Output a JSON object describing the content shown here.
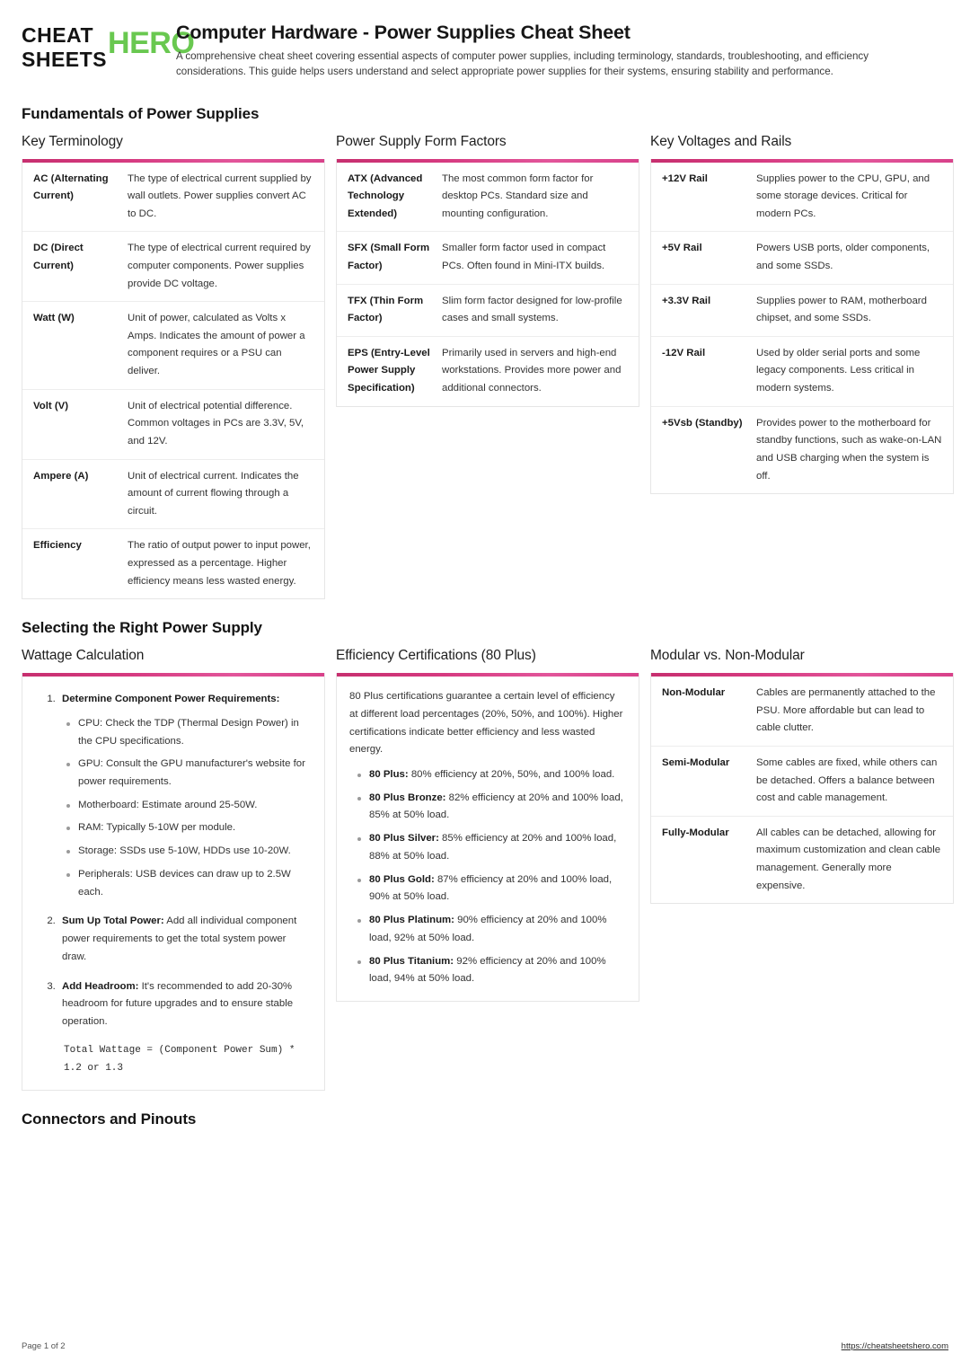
{
  "brand": {
    "logo_line1": "CHEAT",
    "logo_line2": "SHEETS",
    "logo_accent": "HERO",
    "accent_green": "#69c850",
    "accent_pink": "#d6367a"
  },
  "header": {
    "title": "Computer Hardware - Power Supplies Cheat Sheet",
    "subtitle": "A comprehensive cheat sheet covering essential aspects of computer power supplies, including terminology, standards, troubleshooting, and efficiency considerations. This guide helps users understand and select appropriate power supplies for their systems, ensuring stability and performance."
  },
  "sections": [
    {
      "heading": "Fundamentals of Power Supplies"
    },
    {
      "heading": "Selecting the Right Power Supply"
    },
    {
      "heading": "Connectors and Pinouts"
    }
  ],
  "cards": {
    "key_terminology": {
      "title": "Key Terminology",
      "rows": [
        {
          "term": "AC (Alternating Current)",
          "desc": "The type of electrical current supplied by wall outlets. Power supplies convert AC to DC."
        },
        {
          "term": "DC (Direct Current)",
          "desc": "The type of electrical current required by computer components. Power supplies provide DC voltage."
        },
        {
          "term": "Watt (W)",
          "desc": "Unit of power, calculated as Volts x Amps. Indicates the amount of power a component requires or a PSU can deliver."
        },
        {
          "term": "Volt (V)",
          "desc": "Unit of electrical potential difference. Common voltages in PCs are 3.3V, 5V, and 12V."
        },
        {
          "term": "Ampere (A)",
          "desc": "Unit of electrical current. Indicates the amount of current flowing through a circuit."
        },
        {
          "term": "Efficiency",
          "desc": "The ratio of output power to input power, expressed as a percentage. Higher efficiency means less wasted energy."
        }
      ]
    },
    "form_factors": {
      "title": "Power Supply Form Factors",
      "rows": [
        {
          "term": "ATX (Advanced Technology Extended)",
          "desc": "The most common form factor for desktop PCs. Standard size and mounting configuration."
        },
        {
          "term": "SFX (Small Form Factor)",
          "desc": "Smaller form factor used in compact PCs. Often found in Mini-ITX builds."
        },
        {
          "term": "TFX (Thin Form Factor)",
          "desc": "Slim form factor designed for low-profile cases and small systems."
        },
        {
          "term": "EPS (Entry-Level Power Supply Specification)",
          "desc": "Primarily used in servers and high-end workstations. Provides more power and additional connectors."
        }
      ]
    },
    "voltages": {
      "title": "Key Voltages and Rails",
      "rows": [
        {
          "term": "+12V Rail",
          "desc": "Supplies power to the CPU, GPU, and some storage devices. Critical for modern PCs."
        },
        {
          "term": "+5V Rail",
          "desc": "Powers USB ports, older components, and some SSDs."
        },
        {
          "term": "+3.3V Rail",
          "desc": "Supplies power to RAM, motherboard chipset, and some SSDs."
        },
        {
          "term": "-12V Rail",
          "desc": "Used by older serial ports and some legacy components. Less critical in modern systems."
        },
        {
          "term": "+5Vsb (Standby)",
          "desc": "Provides power to the motherboard for standby functions, such as wake-on-LAN and USB charging when the system is off."
        }
      ]
    },
    "wattage": {
      "title": "Wattage Calculation",
      "steps": [
        {
          "strong": "Determine Component Power Requirements:",
          "rest": "",
          "bullets": [
            "CPU: Check the TDP (Thermal Design Power) in the CPU specifications.",
            "GPU: Consult the GPU manufacturer's website for power requirements.",
            "Motherboard: Estimate around 25-50W.",
            "RAM: Typically 5-10W per module.",
            "Storage: SSDs use 5-10W, HDDs use 10-20W.",
            "Peripherals: USB devices can draw up to 2.5W each."
          ]
        },
        {
          "strong": "Sum Up Total Power:",
          "rest": " Add all individual component power requirements to get the total system power draw.",
          "bullets": []
        },
        {
          "strong": "Add Headroom:",
          "rest": " It's recommended to add 20-30% headroom for future upgrades and to ensure stable operation.",
          "bullets": []
        }
      ],
      "code": "Total Wattage = (Component Power Sum) * 1.2 or 1.3"
    },
    "efficiency": {
      "title": "Efficiency Certifications (80 Plus)",
      "intro": "80 Plus certifications guarantee a certain level of efficiency at different load percentages (20%, 50%, and 100%). Higher certifications indicate better efficiency and less wasted energy.",
      "items": [
        {
          "strong": "80 Plus:",
          "rest": " 80% efficiency at 20%, 50%, and 100% load."
        },
        {
          "strong": "80 Plus Bronze:",
          "rest": " 82% efficiency at 20% and 100% load, 85% at 50% load."
        },
        {
          "strong": "80 Plus Silver:",
          "rest": " 85% efficiency at 20% and 100% load, 88% at 50% load."
        },
        {
          "strong": "80 Plus Gold:",
          "rest": " 87% efficiency at 20% and 100% load, 90% at 50% load."
        },
        {
          "strong": "80 Plus Platinum:",
          "rest": " 90% efficiency at 20% and 100% load, 92% at 50% load."
        },
        {
          "strong": "80 Plus Titanium:",
          "rest": " 92% efficiency at 20% and 100% load, 94% at 50% load."
        }
      ]
    },
    "modular": {
      "title": "Modular vs. Non-Modular",
      "rows": [
        {
          "term": "Non-Modular",
          "desc": "Cables are permanently attached to the PSU. More affordable but can lead to cable clutter."
        },
        {
          "term": "Semi-Modular",
          "desc": "Some cables are fixed, while others can be detached. Offers a balance between cost and cable management."
        },
        {
          "term": "Fully-Modular",
          "desc": "All cables can be detached, allowing for maximum customization and clean cable management. Generally more expensive."
        }
      ]
    }
  },
  "footer": {
    "page_label": "Page 1 of 2",
    "url": "https://cheatsheetshero.com"
  }
}
